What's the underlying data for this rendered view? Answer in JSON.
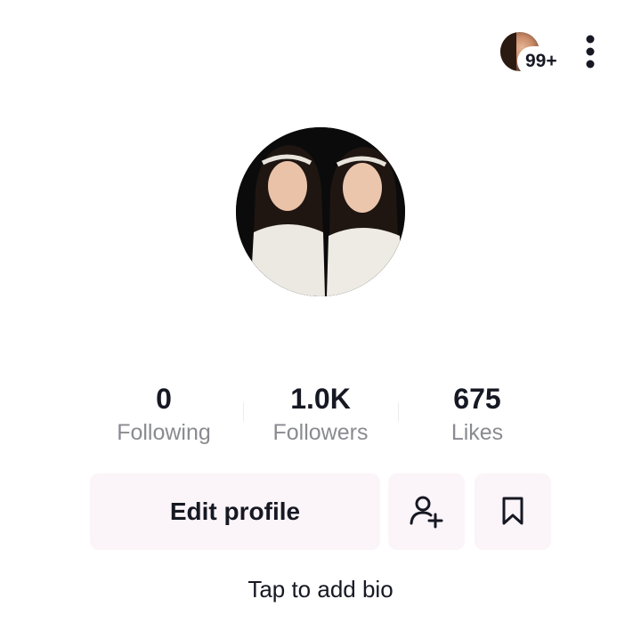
{
  "header": {
    "notification_badge": "99+",
    "more_icon": "more-vertical-icon"
  },
  "profile": {
    "avatar_icon": "profile-photo"
  },
  "stats": [
    {
      "value": "0",
      "label": "Following"
    },
    {
      "value": "1.0K",
      "label": "Followers"
    },
    {
      "value": "675",
      "label": "Likes"
    }
  ],
  "actions": {
    "edit_profile_label": "Edit profile",
    "add_friend_icon": "add-user-icon",
    "favorites_icon": "bookmark-icon"
  },
  "bio": {
    "placeholder": "Tap to add bio"
  },
  "colors": {
    "text_primary": "#161823",
    "text_secondary": "#8a8b91",
    "button_background": "#fbf4f8"
  }
}
